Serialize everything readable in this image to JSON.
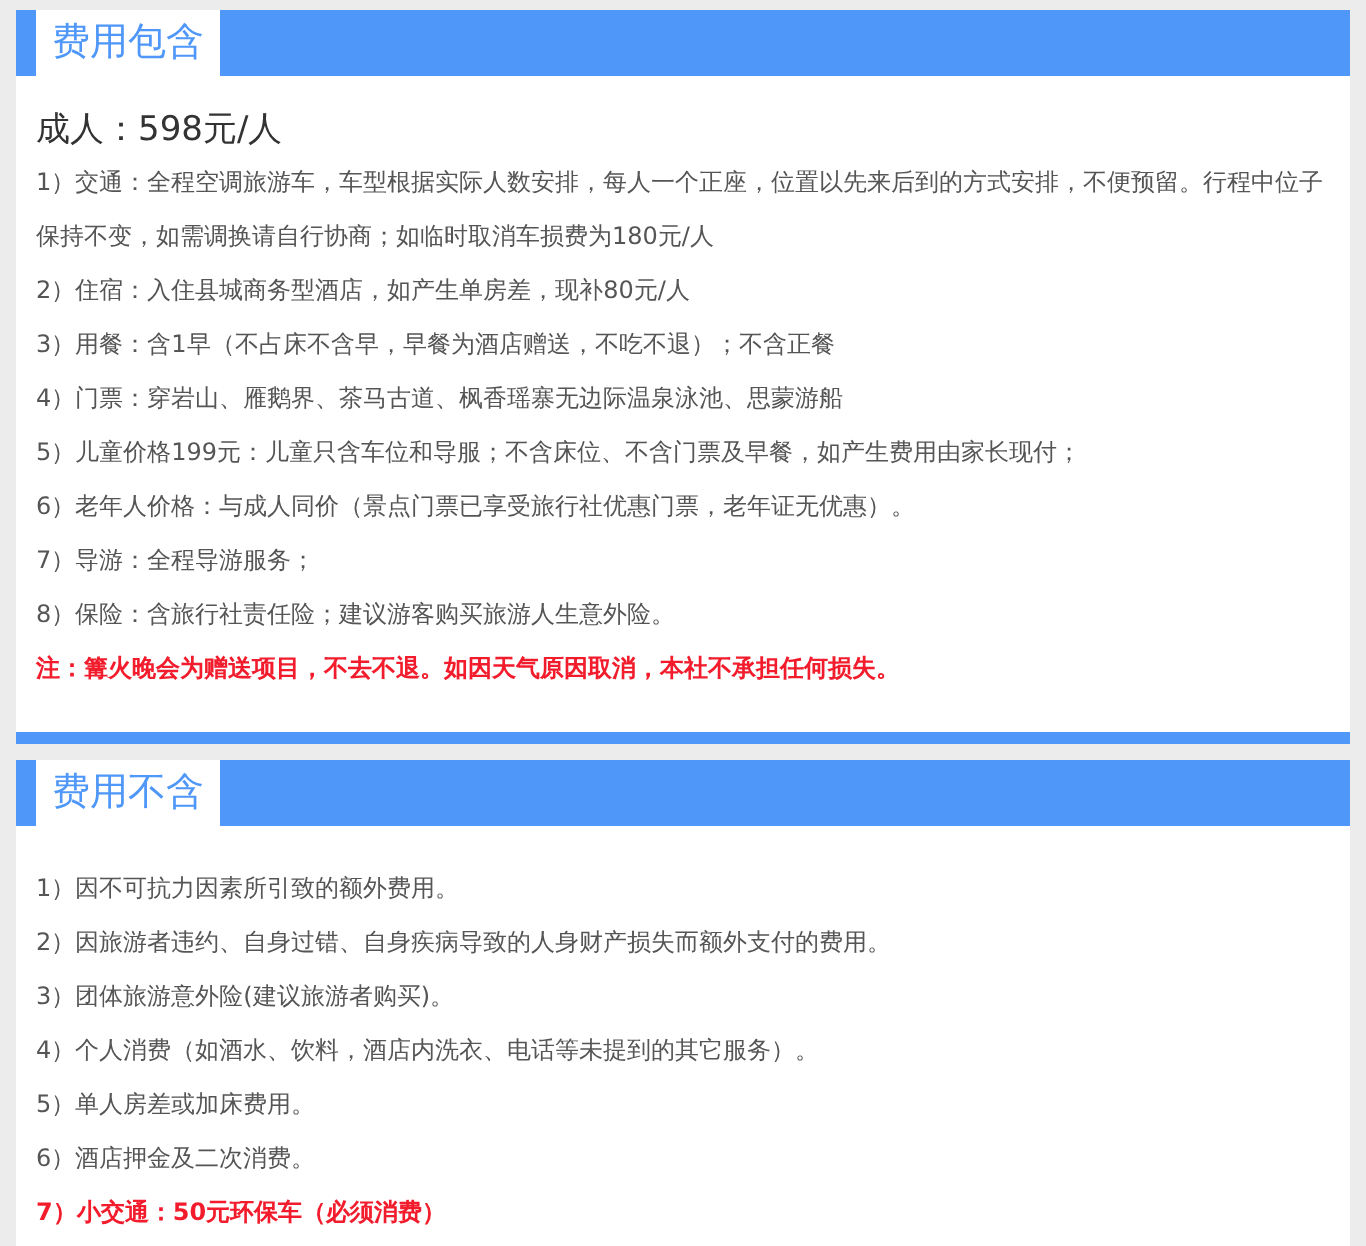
{
  "sections": [
    {
      "title": "费用包含",
      "price": "成人：598元/人",
      "items": [
        {
          "kind": "text",
          "text": "1）交通：全程空调旅游车，车型根据实际人数安排，每人一个正座，位置以先来后到的方式安排，不便预留。行程中位子保持不变，如需调换请自行协商；如临时取消车损费为180元/人"
        },
        {
          "kind": "text",
          "text": "2）住宿：入住县城商务型酒店，如产生单房差，现补80元/人"
        },
        {
          "kind": "text",
          "text": "3）用餐：含1早（不占床不含早，早餐为酒店赠送，不吃不退）；不含正餐"
        },
        {
          "kind": "text",
          "text": "4）门票：穿岩山、雁鹅界、茶马古道、枫香瑶寨无边际温泉泳池、思蒙游船"
        },
        {
          "kind": "text",
          "text": "5）儿童价格199元：儿童只含车位和导服；不含床位、不含门票及早餐，如产生费用由家长现付；"
        },
        {
          "kind": "text",
          "text": "6）老年人价格：与成人同价（景点门票已享受旅行社优惠门票，老年证无优惠）。"
        },
        {
          "kind": "text",
          "text": "7）导游：全程导游服务；"
        },
        {
          "kind": "text",
          "text": "8）保险：含旅行社责任险；建议游客购买旅游人生意外险。"
        },
        {
          "kind": "note",
          "text": "注：篝火晚会为赠送项目，不去不退。如因天气原因取消，本社不承担任何损失。"
        }
      ]
    },
    {
      "title": "费用不含",
      "items": [
        {
          "kind": "text",
          "text": "1）因不可抗力因素所引致的额外费用。"
        },
        {
          "kind": "text",
          "text": "2）因旅游者违约、自身过错、自身疾病导致的人身财产损失而额外支付的费用。"
        },
        {
          "kind": "text",
          "text": "3）团体旅游意外险(建议旅游者购买)。"
        },
        {
          "kind": "text",
          "text": "4）个人消费（如酒水、饮料，酒店内洗衣、电话等未提到的其它服务）。"
        },
        {
          "kind": "text",
          "text": "5）单人房差或加床费用。"
        },
        {
          "kind": "text",
          "text": "6）酒店押金及二次消费。"
        },
        {
          "kind": "note",
          "text": "7）小交通：50元环保车（必须消费）"
        }
      ]
    }
  ]
}
